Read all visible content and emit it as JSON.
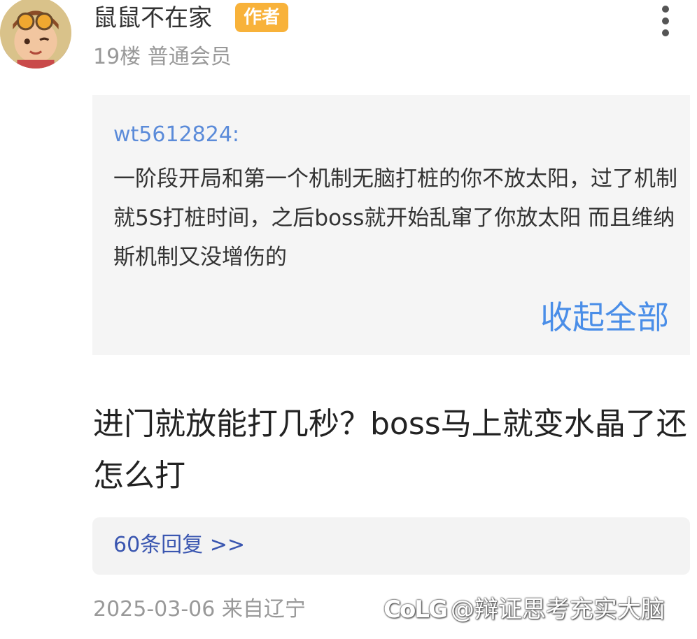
{
  "post": {
    "username": "鼠鼠不在家",
    "badge": "作者",
    "meta": "19楼 普通会员",
    "quote": {
      "user": "wt5612824:",
      "text": "一阶段开局和第一个机制无脑打桩的你不放太阳，过了机制就5S打桩时间，之后boss就开始乱窜了你放太阳 而且维纳斯机制又没增伤的",
      "collapse_label": "收起全部"
    },
    "text": "进门就放能打几秒？boss马上就变水晶了还怎么打",
    "replies_label": "60条回复 >>",
    "date_location": "2025-03-06 来自辽宁"
  },
  "watermark": {
    "logo": "CoLG",
    "text": "@辩证思考充实大脑"
  },
  "icons": {
    "more": "more-vertical-icon",
    "avatar": "avatar-cartoon-boy"
  },
  "colors": {
    "badge": "#f8b23a",
    "quote_user": "#5b8bd9",
    "collapse": "#4a8ee8",
    "replies": "#3a56b0"
  }
}
